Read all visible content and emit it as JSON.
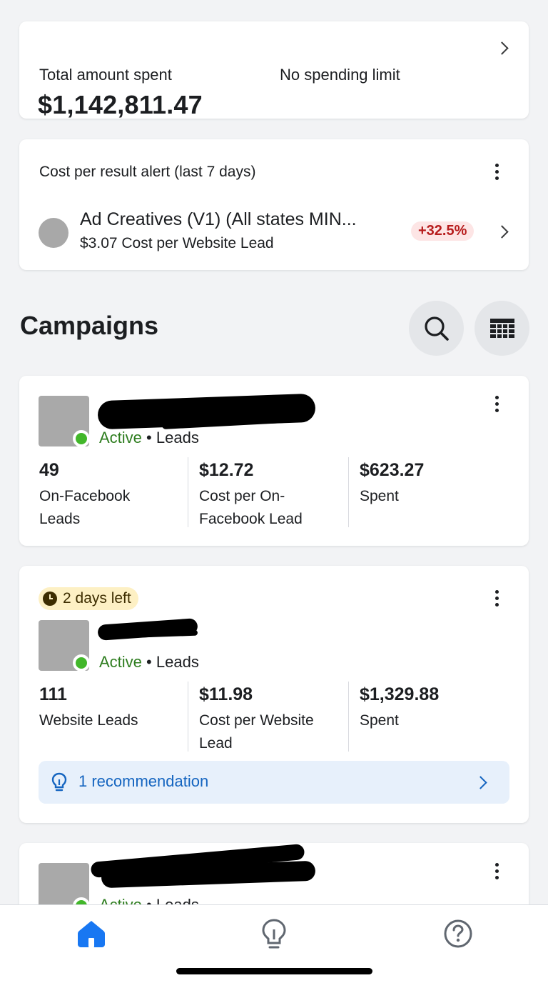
{
  "spend": {
    "label": "Total amount spent",
    "amount": "$1,142,811.47",
    "limit": "No spending limit"
  },
  "alert": {
    "title": "Cost per result alert (last 7 days)",
    "name": "Ad Creatives (V1) (All states MIN...",
    "cost": "$3.07 Cost per Website Lead",
    "change": "+32.5%",
    "change_color": "#b71c1c"
  },
  "campaigns": {
    "title": "Campaigns",
    "search_icon": "search-icon",
    "table_icon": "table-columns-icon",
    "items": [
      {
        "status": "Active",
        "separator": "•",
        "objective": "Leads",
        "metrics": [
          {
            "value": "49",
            "label": "On-Facebook Leads"
          },
          {
            "value": "$12.72",
            "label": "Cost per On-Facebook Lead"
          },
          {
            "value": "$623.27",
            "label": "Spent"
          }
        ]
      },
      {
        "badge": "2 days left",
        "status": "Active",
        "separator": "•",
        "objective": "Leads",
        "metrics": [
          {
            "value": "111",
            "label": "Website Leads"
          },
          {
            "value": "$11.98",
            "label": "Cost per Website Lead"
          },
          {
            "value": "$1,329.88",
            "label": "Spent"
          }
        ],
        "recommendation": "1 recommendation"
      },
      {
        "status": "Active",
        "separator": "•",
        "objective": "Leads"
      }
    ]
  },
  "colors": {
    "accent": "#1877f2",
    "active_green": "#42b72a",
    "badge_yellow": "#fdf0c4",
    "recommendation_bg": "#e7f0fb"
  },
  "nav": {
    "items": [
      {
        "icon": "home-icon",
        "active": true
      },
      {
        "icon": "lightbulb-icon",
        "active": false
      },
      {
        "icon": "help-icon",
        "active": false
      }
    ]
  }
}
